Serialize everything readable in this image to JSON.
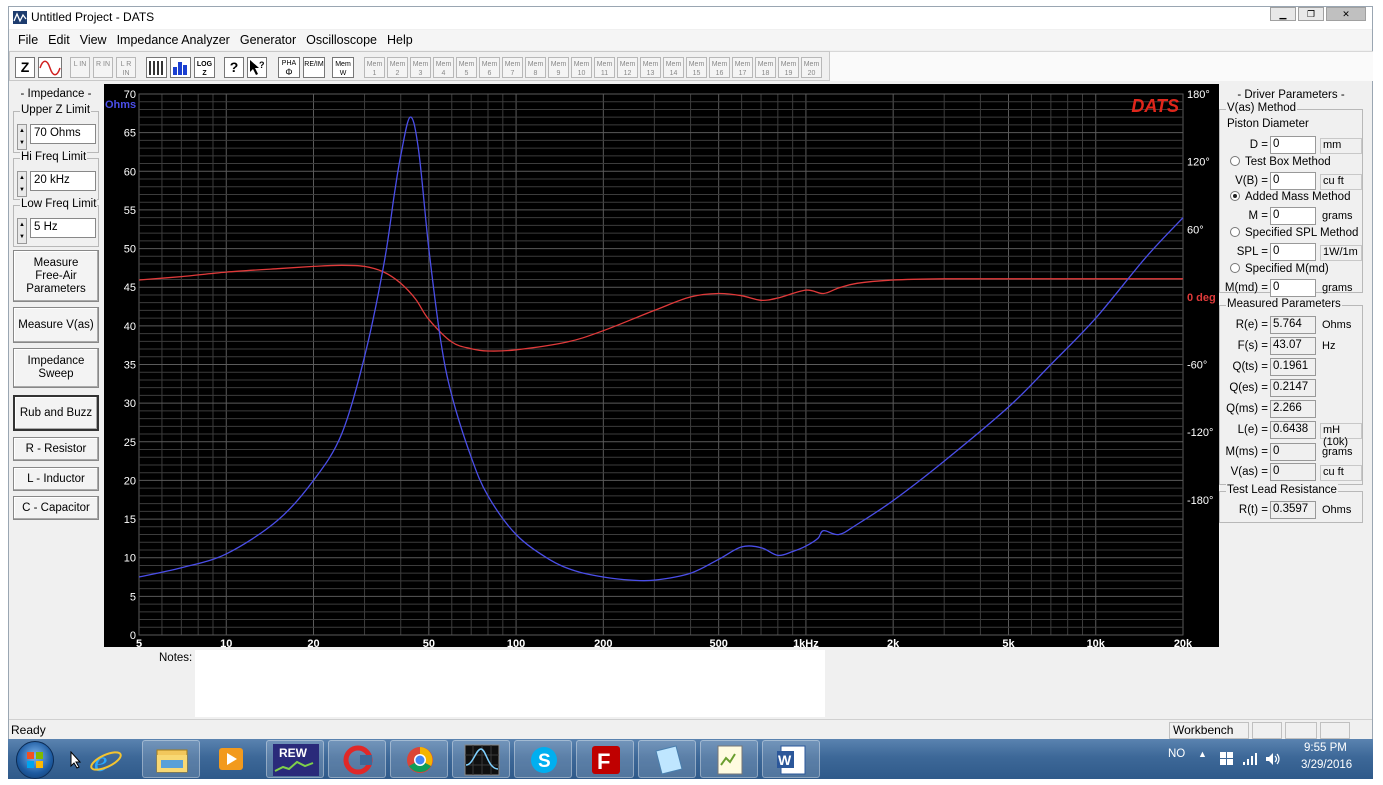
{
  "window": {
    "title": "Untitled Project - DATS",
    "controls": [
      "minimize",
      "restore",
      "close"
    ]
  },
  "menu": [
    "File",
    "Edit",
    "View",
    "Impedance Analyzer",
    "Generator",
    "Oscilloscope",
    "Help"
  ],
  "toolbar": {
    "mode_z": "Z",
    "ch_lin": "L IN",
    "ch_rin": "R IN",
    "ch_lrin": "L R IN",
    "log_label": "LOG Z",
    "pha_label": "PHA",
    "phase_sym": "Φ",
    "re_im_label": "RE/IM",
    "mem_w_label": "Mem W",
    "mem_slots": [
      "Mem 1",
      "Mem 2",
      "Mem 3",
      "Mem 4",
      "Mem 5",
      "Mem 6",
      "Mem 7",
      "Mem 8",
      "Mem 9",
      "Mem 10",
      "Mem 11",
      "Mem 12",
      "Mem 13",
      "Mem 14",
      "Mem 15",
      "Mem 16",
      "Mem 17",
      "Mem 18",
      "Mem 19",
      "Mem 20"
    ]
  },
  "left_panel": {
    "title": "- Impedance -",
    "upper_z_limit": {
      "label": "Upper Z Limit",
      "value": "70 Ohms"
    },
    "hi_freq_limit": {
      "label": "Hi Freq Limit",
      "value": "20 kHz"
    },
    "low_freq_limit": {
      "label": "Low Freq Limit",
      "value": "5 Hz"
    },
    "buttons": {
      "measure_free_air": "Measure Free-Air Parameters",
      "measure_vas": "Measure V(as)",
      "impedance_sweep": "Impedance Sweep",
      "rub_buzz": "Rub and Buzz",
      "resistor": "R - Resistor",
      "inductor": "L - Inductor",
      "capacitor": "C - Capacitor"
    }
  },
  "chart_data": {
    "type": "line",
    "watermark": "DATS",
    "x_scale": "log",
    "xlim": [
      5,
      20000
    ],
    "x_ticks": [
      "5",
      "10",
      "20",
      "50",
      "100",
      "200",
      "500",
      "1kHz",
      "2k",
      "5k",
      "10k",
      "20k"
    ],
    "y_left_label": "Ohms",
    "ylim": [
      0,
      70
    ],
    "y_left_ticks": [
      "0",
      "5",
      "10",
      "15",
      "20",
      "25",
      "30",
      "35",
      "40",
      "45",
      "50",
      "55",
      "60",
      "65",
      "70"
    ],
    "y_right_ticks": [
      "180°",
      "120°",
      "60°",
      "0 deg",
      "-60°",
      "-120°",
      "-180°"
    ],
    "y_right_lim": [
      -300,
      180
    ],
    "colors": {
      "impedance": "#4a4ee8",
      "phase": "#e03a3a",
      "background": "#000000",
      "grid": "#3c3c3c",
      "watermark": "#e0261b"
    },
    "series": [
      {
        "axis": "left",
        "x": [
          5,
          7,
          10,
          15,
          20,
          25,
          30,
          35,
          38,
          40,
          43.07,
          46,
          50,
          55,
          60,
          70,
          80,
          100,
          130,
          160,
          200,
          250,
          300,
          400,
          500,
          600,
          700,
          800,
          900,
          1000,
          1100,
          1150,
          1300,
          1500,
          2000,
          3000,
          5000,
          7000,
          10000,
          15000,
          20000
        ],
        "y": [
          7.5,
          8.7,
          10.5,
          14.8,
          20,
          26,
          36,
          48,
          57,
          62,
          67,
          63,
          50,
          38,
          31,
          23,
          18,
          13,
          9.8,
          8.3,
          7.5,
          7.1,
          7.1,
          8.0,
          9.8,
          11.4,
          11.3,
          10.3,
          10.8,
          11.5,
          12.5,
          13.5,
          13.0,
          14.3,
          17.4,
          22.5,
          29.5,
          35,
          41,
          49,
          54
        ]
      },
      {
        "axis": "right",
        "x": [
          5,
          7,
          10,
          15,
          20,
          25,
          30,
          35,
          40,
          45,
          50,
          60,
          70,
          80,
          100,
          150,
          200,
          300,
          400,
          500,
          600,
          700,
          800,
          1000,
          1150,
          1300,
          1500,
          2000,
          3000,
          5000,
          10000,
          20000
        ],
        "y": [
          15,
          18,
          22,
          25,
          27,
          28,
          27,
          22,
          12,
          -2,
          -20,
          -40,
          -46,
          -48,
          -47,
          -40,
          -30,
          -12,
          0,
          3,
          1,
          -3,
          -1,
          6,
          3,
          8,
          12,
          15,
          16,
          16,
          16,
          16
        ]
      }
    ]
  },
  "notes": {
    "label": "Notes:",
    "value": ""
  },
  "right_panel": {
    "title": "- Driver Parameters -",
    "vas_method": "V(as) Method",
    "piston_diameter": "Piston Diameter",
    "d": {
      "label": "D =",
      "value": "0",
      "unit": "mm"
    },
    "test_box": {
      "label": "Test Box Method",
      "selected": false
    },
    "vb": {
      "label": "V(B) =",
      "value": "0",
      "unit": "cu ft"
    },
    "added_mass": {
      "label": "Added Mass Method",
      "selected": true
    },
    "m": {
      "label": "M =",
      "value": "0",
      "unit": "grams"
    },
    "specified_spl": {
      "label": "Specified SPL Method",
      "selected": false
    },
    "spl": {
      "label": "SPL =",
      "value": "0",
      "unit": "1W/1m"
    },
    "specified_mmd": {
      "label": "Specified M(md)",
      "selected": false
    },
    "mmd": {
      "label": "M(md) =",
      "value": "0",
      "unit": "grams"
    },
    "measured": {
      "title": "Measured Parameters",
      "re": {
        "label": "R(e) =",
        "value": "5.764",
        "unit": "Ohms"
      },
      "fs": {
        "label": "F(s) =",
        "value": "43.07",
        "unit": "Hz"
      },
      "qts": {
        "label": "Q(ts) =",
        "value": "0.1961",
        "unit": ""
      },
      "qes": {
        "label": "Q(es) =",
        "value": "0.2147",
        "unit": ""
      },
      "qms": {
        "label": "Q(ms) =",
        "value": "2.266",
        "unit": ""
      },
      "le": {
        "label": "L(e) =",
        "value": "0.6438",
        "unit": "mH (10k)"
      },
      "mms": {
        "label": "M(ms) =",
        "value": "0",
        "unit": "grams"
      },
      "vas": {
        "label": "V(as) =",
        "value": "0",
        "unit": "cu ft"
      }
    },
    "lead": {
      "title": "Test Lead Resistance",
      "rt": {
        "label": "R(t) =",
        "value": "0.3597",
        "unit": "Ohms"
      }
    }
  },
  "status": {
    "text": "Ready",
    "pane": "Workbench"
  },
  "taskbar": {
    "apps": [
      "start",
      "internet-explorer",
      "file-explorer",
      "media-player",
      "rew",
      "ccleaner",
      "chrome",
      "oscilloscope-app",
      "skype",
      "filezilla",
      "notepad",
      "notepad-plus-plus",
      "word"
    ],
    "rew_label": "REW",
    "lang": "NO",
    "time": "9:55 PM",
    "date": "3/29/2016"
  }
}
